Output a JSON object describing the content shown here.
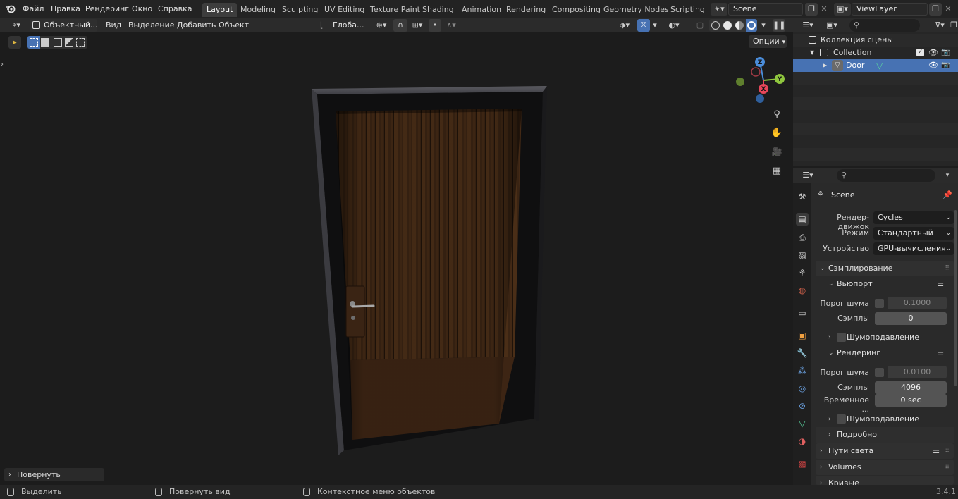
{
  "topbar": {
    "menus": [
      "Файл",
      "Правка",
      "Рендеринг",
      "Окно",
      "Справка"
    ],
    "workspaces": [
      "Layout",
      "Modeling",
      "Sculpting",
      "UV Editing",
      "Texture Paint",
      "Shading",
      "Animation",
      "Rendering",
      "Compositing",
      "Geometry Nodes",
      "Scripting"
    ],
    "active_workspace": "Layout",
    "scene_name": "Scene",
    "view_layer": "ViewLayer"
  },
  "viewport_header": {
    "mode": "Объектный...",
    "menus": [
      "Вид",
      "Выделение",
      "Добавить",
      "Объект"
    ],
    "orientation": "Глоба...",
    "options_label": "Опции"
  },
  "viewport": {
    "last_op_panel": "Повернуть",
    "gizmo_axes": [
      "Z",
      "Y",
      "X"
    ]
  },
  "outliner": {
    "root": "Коллекция сцены",
    "collection": "Collection",
    "object": "Door"
  },
  "properties": {
    "scene_name": "Scene",
    "engine_label": "Рендер-движок",
    "engine_value": "Cycles",
    "mode_label": "Режим",
    "mode_value": "Стандартный",
    "device_label": "Устройство",
    "device_value": "GPU-вычисления",
    "sampling": "Сэмплирование",
    "viewport": "Вьюпорт",
    "noise_threshold_label": "Порог шума",
    "viewport_noise_threshold": "0.1000",
    "samples_label": "Сэмплы",
    "viewport_samples": "0",
    "denoising": "Шумоподавление",
    "render": "Рендеринг",
    "render_noise_threshold": "0.0100",
    "render_samples": "4096",
    "time_limit_label": "Временное ...",
    "time_limit_value": "0 sec",
    "advanced": "Подробно",
    "light_paths": "Пути света",
    "volumes": "Volumes",
    "curves": "Кривые"
  },
  "statusbar": {
    "select": "Выделить",
    "rotate_view": "Повернуть вид",
    "context_menu": "Контекстное меню объектов",
    "version": "3.4.1"
  },
  "colors": {
    "accent_blue": "#4772b3",
    "axis_x": "#e8475a",
    "axis_y": "#8fc63e",
    "axis_z": "#4a8cd9"
  }
}
